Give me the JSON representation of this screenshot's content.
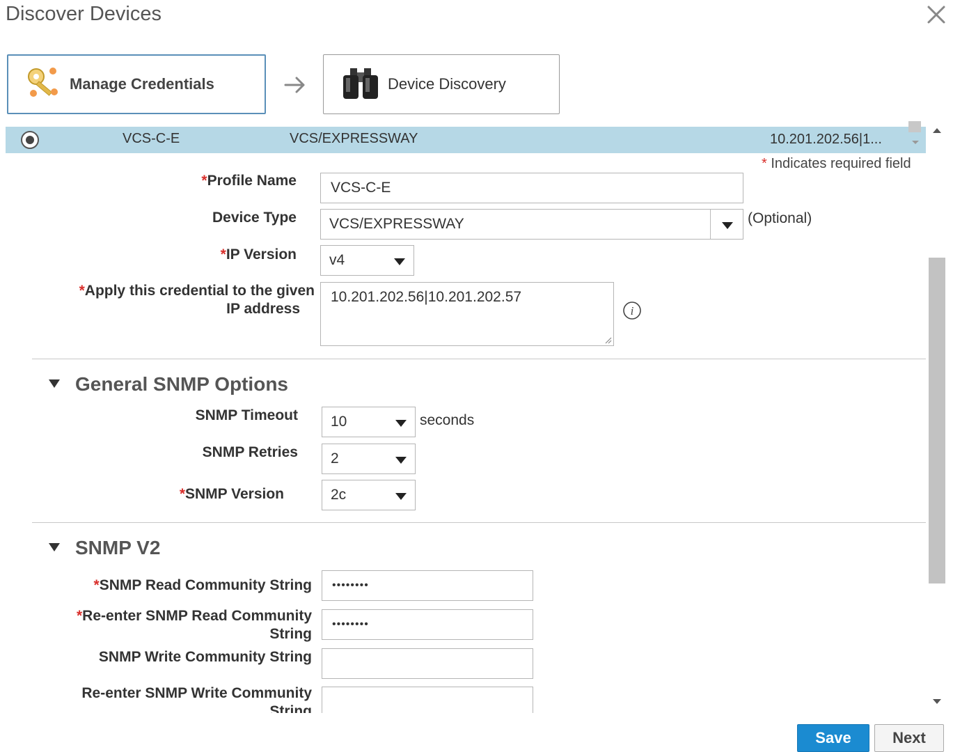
{
  "dialog": {
    "title": "Discover Devices"
  },
  "steps": [
    {
      "label": "Manage Credentials",
      "icon": "keys-icon"
    },
    {
      "label": "Device Discovery",
      "icon": "binoculars-icon"
    }
  ],
  "selected_row": {
    "name": "VCS-C-E",
    "type": "VCS/EXPRESSWAY",
    "ip": "10.201.202.56|1..."
  },
  "required_note": {
    "star": "*",
    "text": " Indicates required field"
  },
  "form": {
    "profile_name": {
      "label": "Profile Name",
      "value": "VCS-C-E"
    },
    "device_type": {
      "label": "Device Type",
      "value": "VCS/EXPRESSWAY",
      "hint": "(Optional)"
    },
    "ip_version": {
      "label": "IP Version",
      "value": "v4"
    },
    "ip_address": {
      "label_line1": "Apply this credential to the given",
      "label_line2": "IP address",
      "value": "10.201.202.56|10.201.202.57"
    }
  },
  "general_snmp": {
    "title": "General SNMP Options",
    "timeout": {
      "label": "SNMP Timeout",
      "value": "10",
      "unit": "seconds"
    },
    "retries": {
      "label": "SNMP Retries",
      "value": "2"
    },
    "version": {
      "label": "SNMP Version",
      "value": "2c"
    }
  },
  "snmp_v2": {
    "title": "SNMP V2",
    "read": {
      "label": "SNMP Read Community String",
      "value": "••••••••"
    },
    "reread": {
      "label_line1": "Re-enter SNMP Read Community",
      "label_line2": "String",
      "value": "••••••••"
    },
    "write": {
      "label": "SNMP Write Community String",
      "value": ""
    },
    "rewrite": {
      "label_line1": "Re-enter SNMP Write Community",
      "label_line2": "String",
      "value": ""
    }
  },
  "buttons": {
    "save": "Save",
    "next": "Next"
  },
  "colors": {
    "primary": "#1b8bd1",
    "selected_row": "#b6d8e6",
    "required": "#d9302c"
  }
}
